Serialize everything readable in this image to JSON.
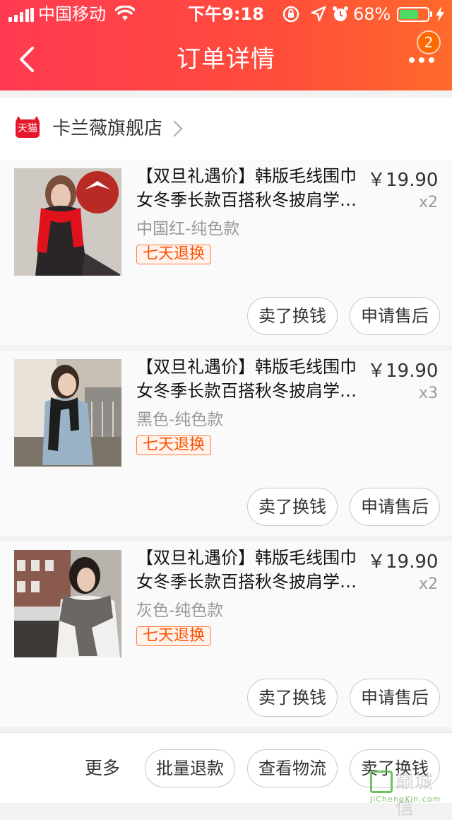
{
  "status_bar": {
    "carrier": "中国移动",
    "time": "下午9:18",
    "battery_percent": "68%",
    "battery_level": 0.68
  },
  "nav": {
    "title": "订单详情",
    "badge_count": "2"
  },
  "shop": {
    "logo_text": "天猫",
    "name": "卡兰薇旗舰店"
  },
  "items": [
    {
      "title_line1": "【双旦礼遇价】韩版毛线围巾",
      "title_line2": "女冬季长款百搭秋冬披肩学生…",
      "price": "￥19.90",
      "qty": "x2",
      "sku": "中国红-纯色款",
      "tag": "七天退换",
      "buttons": [
        "卖了换钱",
        "申请售后"
      ]
    },
    {
      "title_line1": "【双旦礼遇价】韩版毛线围巾",
      "title_line2": "女冬季长款百搭秋冬披肩学生…",
      "price": "￥19.90",
      "qty": "x3",
      "sku": "黑色-纯色款",
      "tag": "七天退换",
      "buttons": [
        "卖了换钱",
        "申请售后"
      ]
    },
    {
      "title_line1": "【双旦礼遇价】韩版毛线围巾",
      "title_line2": "女冬季长款百搭秋冬披肩学生…",
      "price": "￥19.90",
      "qty": "x2",
      "sku": "灰色-纯色款",
      "tag": "七天退换",
      "buttons": [
        "卖了换钱",
        "申请售后"
      ]
    }
  ],
  "bottom_bar": {
    "more": "更多",
    "buttons": [
      "批量退款",
      "查看物流",
      "卖了换钱"
    ]
  },
  "watermark": {
    "text": "巅城信",
    "sub": "JiChengXin.com"
  },
  "colors": {
    "header_start": "#ff3a52",
    "header_end": "#ff6a2b",
    "tag_orange": "#ff5000",
    "tmall_red": "#e5182b"
  }
}
